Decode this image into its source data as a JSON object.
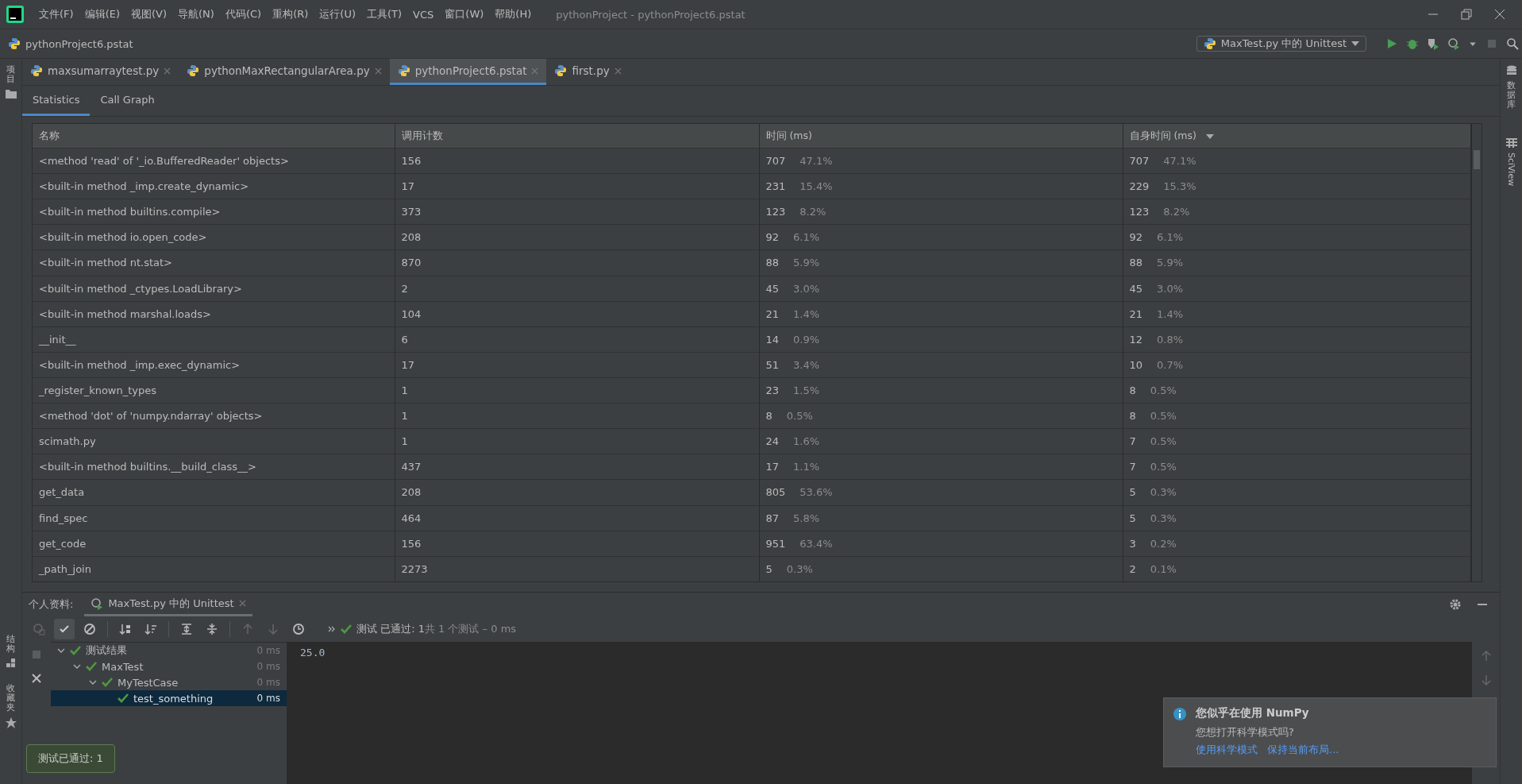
{
  "window": {
    "title": "pythonProject - pythonProject6.pstat"
  },
  "menu": [
    "文件(F)",
    "编辑(E)",
    "视图(V)",
    "导航(N)",
    "代码(C)",
    "重构(R)",
    "运行(U)",
    "工具(T)",
    "VCS",
    "窗口(W)",
    "帮助(H)"
  ],
  "breadcrumb": "pythonProject6.pstat",
  "run_config": "MaxTest.py 中的 Unittest",
  "left_strip": [
    {
      "label": "项目",
      "kind": "folder"
    }
  ],
  "right_strip": [
    {
      "label": "数据库",
      "kind": "database"
    },
    {
      "label": "SciView",
      "kind": "grid"
    }
  ],
  "editor_tabs": [
    {
      "label": "maxsumarraytest.py",
      "selected": false
    },
    {
      "label": "pythonMaxRectangularArea.py",
      "selected": false
    },
    {
      "label": "pythonProject6.pstat",
      "selected": true
    },
    {
      "label": "first.py",
      "selected": false
    }
  ],
  "view_tabs": [
    {
      "label": "Statistics",
      "selected": true
    },
    {
      "label": "Call Graph",
      "selected": false
    }
  ],
  "table": {
    "columns": [
      {
        "label": "名称",
        "sorted": false
      },
      {
        "label": "调用计数",
        "sorted": false
      },
      {
        "label": "时间 (ms)",
        "sorted": false
      },
      {
        "label": "自身时间 (ms)",
        "sorted": true
      }
    ],
    "rows": [
      {
        "name": "<method 'read' of '_io.BufferedReader' objects>",
        "calls": "156",
        "time": "707",
        "time_pct": "47.1%",
        "own": "707",
        "own_pct": "47.1%"
      },
      {
        "name": "<built-in method _imp.create_dynamic>",
        "calls": "17",
        "time": "231",
        "time_pct": "15.4%",
        "own": "229",
        "own_pct": "15.3%"
      },
      {
        "name": "<built-in method builtins.compile>",
        "calls": "373",
        "time": "123",
        "time_pct": "8.2%",
        "own": "123",
        "own_pct": "8.2%"
      },
      {
        "name": "<built-in method io.open_code>",
        "calls": "208",
        "time": "92",
        "time_pct": "6.1%",
        "own": "92",
        "own_pct": "6.1%"
      },
      {
        "name": "<built-in method nt.stat>",
        "calls": "870",
        "time": "88",
        "time_pct": "5.9%",
        "own": "88",
        "own_pct": "5.9%"
      },
      {
        "name": "<built-in method _ctypes.LoadLibrary>",
        "calls": "2",
        "time": "45",
        "time_pct": "3.0%",
        "own": "45",
        "own_pct": "3.0%"
      },
      {
        "name": "<built-in method marshal.loads>",
        "calls": "104",
        "time": "21",
        "time_pct": "1.4%",
        "own": "21",
        "own_pct": "1.4%"
      },
      {
        "name": "__init__",
        "calls": "6",
        "time": "14",
        "time_pct": "0.9%",
        "own": "12",
        "own_pct": "0.8%"
      },
      {
        "name": "<built-in method _imp.exec_dynamic>",
        "calls": "17",
        "time": "51",
        "time_pct": "3.4%",
        "own": "10",
        "own_pct": "0.7%"
      },
      {
        "name": "_register_known_types",
        "calls": "1",
        "time": "23",
        "time_pct": "1.5%",
        "own": "8",
        "own_pct": "0.5%"
      },
      {
        "name": "<method 'dot' of 'numpy.ndarray' objects>",
        "calls": "1",
        "time": "8",
        "time_pct": "0.5%",
        "own": "8",
        "own_pct": "0.5%"
      },
      {
        "name": "scimath.py",
        "calls": "1",
        "time": "24",
        "time_pct": "1.6%",
        "own": "7",
        "own_pct": "0.5%"
      },
      {
        "name": "<built-in method builtins.__build_class__>",
        "calls": "437",
        "time": "17",
        "time_pct": "1.1%",
        "own": "7",
        "own_pct": "0.5%"
      },
      {
        "name": "get_data",
        "calls": "208",
        "time": "805",
        "time_pct": "53.6%",
        "own": "5",
        "own_pct": "0.3%"
      },
      {
        "name": "find_spec",
        "calls": "464",
        "time": "87",
        "time_pct": "5.8%",
        "own": "5",
        "own_pct": "0.3%"
      },
      {
        "name": "get_code",
        "calls": "156",
        "time": "951",
        "time_pct": "63.4%",
        "own": "3",
        "own_pct": "0.2%"
      },
      {
        "name": "_path_join",
        "calls": "2273",
        "time": "5",
        "time_pct": "0.3%",
        "own": "2",
        "own_pct": "0.1%"
      }
    ]
  },
  "bottom_panel": {
    "title": "个人资料:",
    "tab": "MaxTest.py 中的 Unittest",
    "status": {
      "label": "测试",
      "passed": "已通过: 1",
      "summary": "共 1 个测试 – 0 ms"
    },
    "tree": [
      {
        "label": "测试结果",
        "time": "0 ms",
        "selected": false,
        "expanded": true,
        "children": [
          {
            "label": "MaxTest",
            "time": "0 ms",
            "selected": false,
            "expanded": true,
            "children": [
              {
                "label": "MyTestCase",
                "time": "0 ms",
                "selected": false,
                "expanded": true,
                "children": [
                  {
                    "label": "test_something",
                    "time": "0 ms",
                    "selected": true
                  }
                ]
              }
            ]
          }
        ]
      }
    ],
    "output": "25.0"
  },
  "left_bottom_strip": [
    "结构",
    "收藏夹"
  ],
  "notification": {
    "title": "您似乎在使用 NumPy",
    "body": "您想打开科学模式吗?",
    "links": [
      "使用科学模式",
      "保持当前布局..."
    ]
  },
  "tooltip": "测试已通过: 1"
}
